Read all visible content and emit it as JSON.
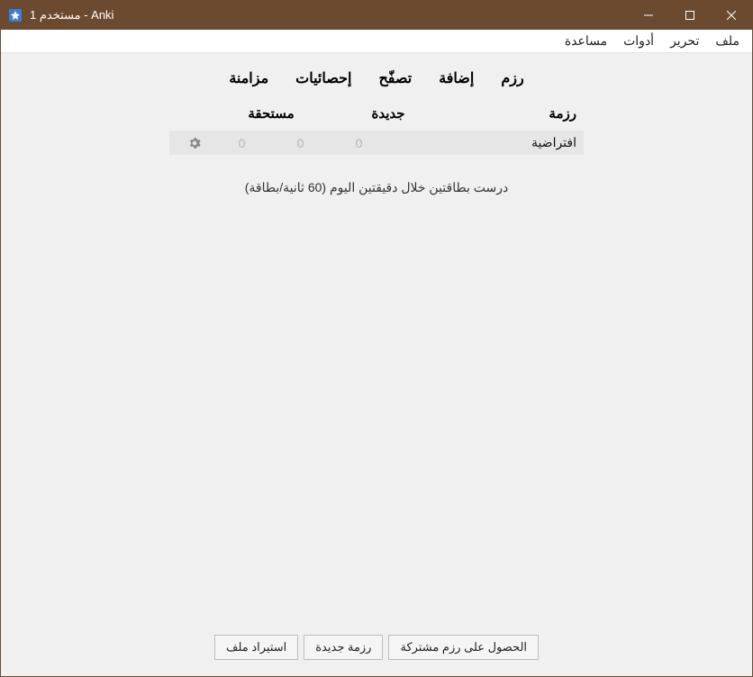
{
  "window": {
    "title": "مستخدم 1 - Anki"
  },
  "menubar": {
    "file": "ملف",
    "edit": "تحرير",
    "tools": "أدوات",
    "help": "مساعدة"
  },
  "toolbar": {
    "decks": "رزم",
    "add": "إضافة",
    "browse": "تصفّح",
    "stats": "إحصائيات",
    "sync": "مزامنة"
  },
  "deck_header": {
    "deck": "رزمة",
    "new": "جديدة",
    "due": "مستحقة"
  },
  "decks": [
    {
      "name": "افتراضية",
      "n1": "0",
      "n2": "0",
      "n3": "0"
    }
  ],
  "status": "درست بطاقتين خلال دقيقتين اليوم (60 ثانية/بطاقة)",
  "footer": {
    "shared": "الحصول على رزم مشتركة",
    "create": "رزمة جديدة",
    "import": "استيراد ملف"
  }
}
